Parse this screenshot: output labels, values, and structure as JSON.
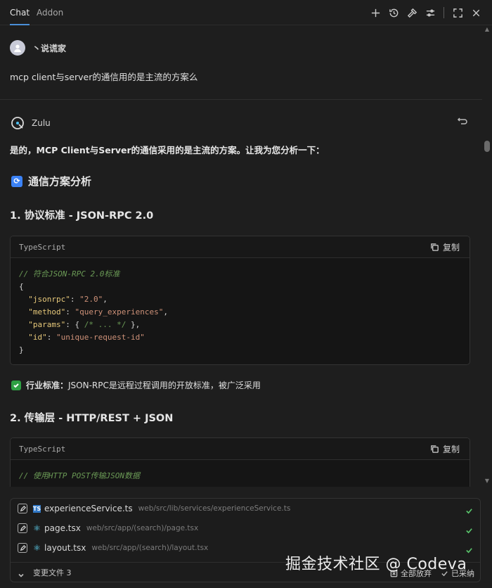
{
  "tabs": [
    {
      "label": "Chat",
      "active": true
    },
    {
      "label": "Addon",
      "active": false
    }
  ],
  "toolbar_icons": [
    "plus-icon",
    "history-icon",
    "hammer-icon",
    "sliders-icon",
    "expand-icon",
    "close-icon"
  ],
  "user": {
    "name": "丶说谎家",
    "message": "mcp client与server的通信用的是主流的方案么"
  },
  "bot": {
    "name": "Zulu"
  },
  "answer": {
    "intro": "是的，MCP Client与Server的通信采用的是主流的方案。让我为您分析一下：",
    "section_icon": "🔄",
    "section_title": "通信方案分析",
    "h1": "1. 协议标准 - JSON-RPC 2.0",
    "code1": {
      "lang": "TypeScript",
      "copy_label": "复制",
      "comment": "// 符合JSON-RPC 2.0标准",
      "open": "{",
      "l1k": "\"jsonrpc\"",
      "l1v": "\"2.0\"",
      "l2k": "\"method\"",
      "l2v": "\"query_experiences\"",
      "l3k": "\"params\"",
      "l3v": "{ ",
      "l3c": "/* ... */",
      "l3e": " },",
      "l4k": "\"id\"",
      "l4v": "\"unique-request-id\"",
      "close": "}"
    },
    "note_bold": "行业标准：",
    "note_text": "JSON-RPC是远程过程调用的开放标准，被广泛采用",
    "h2": "2. 传输层 - HTTP/REST + JSON",
    "code2": {
      "lang": "TypeScript",
      "copy_label": "复制",
      "comment": "// 使用HTTP POST传输JSON数据"
    }
  },
  "changes": {
    "files": [
      {
        "name": "experienceService.ts",
        "path": "web/src/lib/services/experienceService.ts",
        "type": "ts"
      },
      {
        "name": "page.tsx",
        "path": "web/src/app/(search)/page.tsx",
        "type": "tsx"
      },
      {
        "name": "layout.tsx",
        "path": "web/src/app/(search)/layout.tsx",
        "type": "tsx"
      }
    ],
    "footer_label": "变更文件 3",
    "discard_label": "全部放弃",
    "accept_label": "已采纳"
  },
  "watermark": "掘金技术社区 @ Codeva",
  "colors": {
    "accent": "#4a8fd8",
    "success": "#2ea043",
    "bg": "#1e1e1e"
  }
}
